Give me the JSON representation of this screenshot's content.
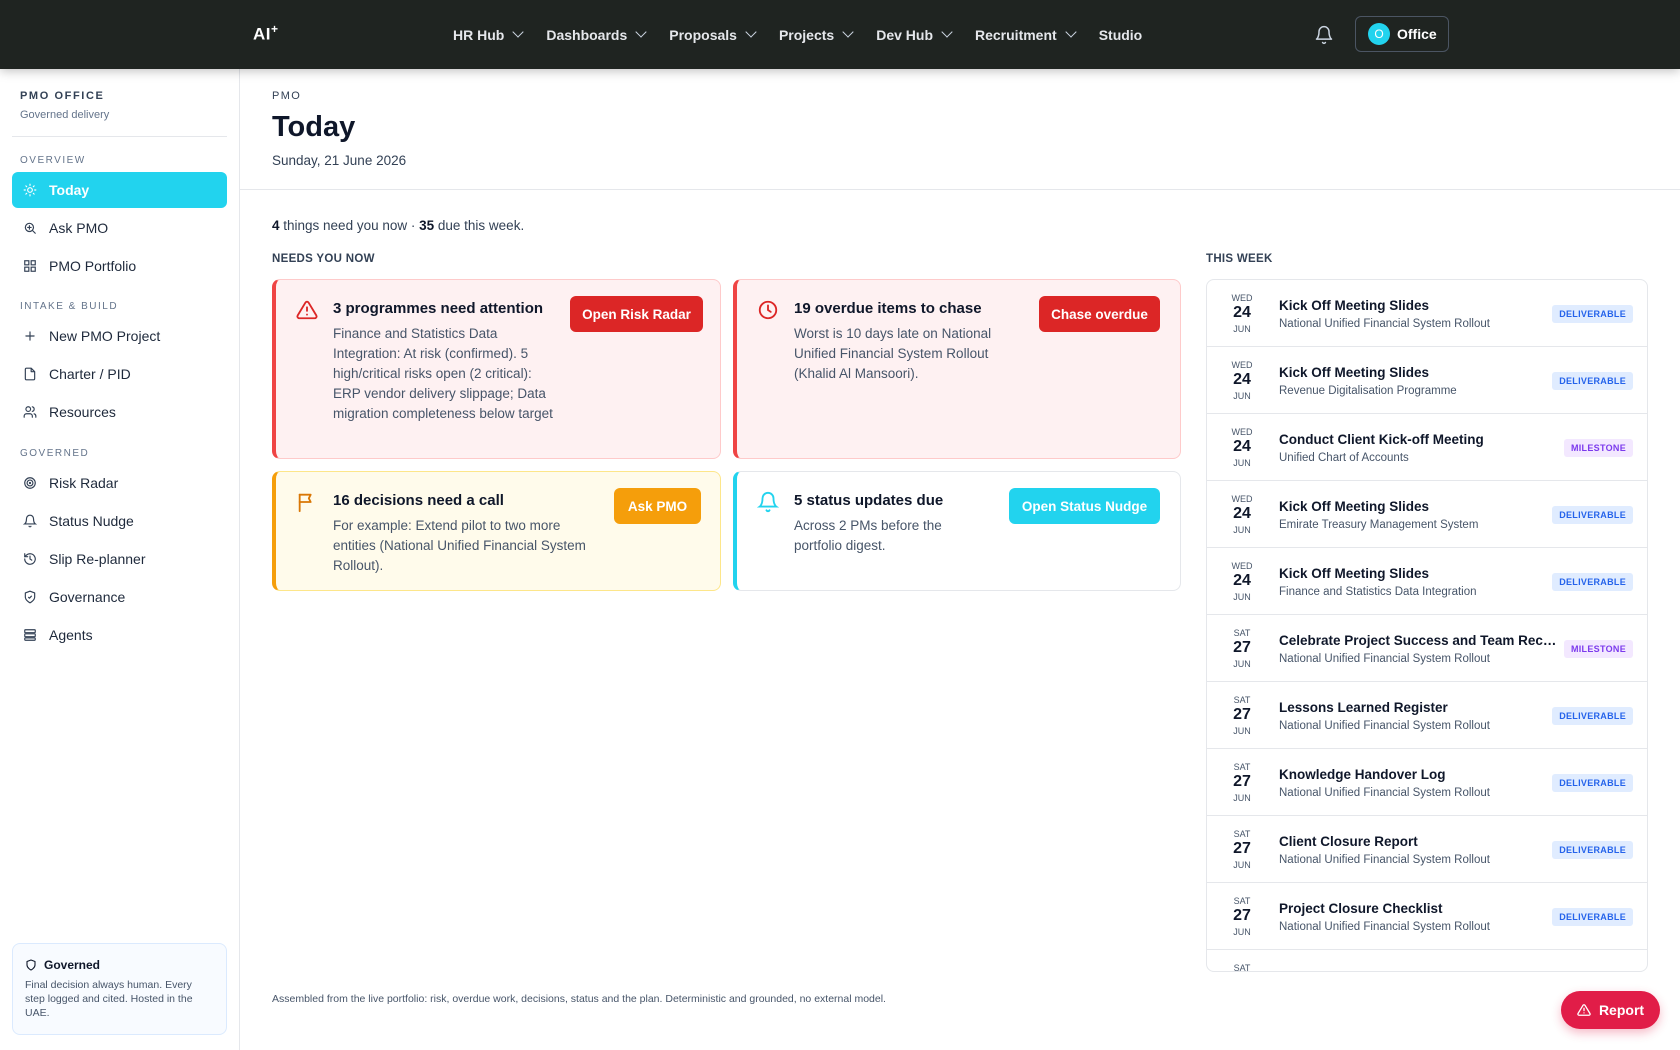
{
  "brand": {
    "logo": "AI",
    "logo_sup": "+"
  },
  "nav": {
    "items": [
      {
        "label": "HR Hub",
        "dropdown": true
      },
      {
        "label": "Dashboards",
        "dropdown": true
      },
      {
        "label": "Proposals",
        "dropdown": true
      },
      {
        "label": "Projects",
        "dropdown": true
      },
      {
        "label": "Dev Hub",
        "dropdown": true
      },
      {
        "label": "Recruitment",
        "dropdown": true
      },
      {
        "label": "Studio",
        "dropdown": false
      }
    ],
    "office_avatar": "O",
    "office_label": "Office"
  },
  "sidebar": {
    "title": "PMO OFFICE",
    "subtitle": "Governed delivery",
    "sections": {
      "overview": "OVERVIEW",
      "intake": "INTAKE & BUILD",
      "governed": "GOVERNED"
    },
    "items": [
      {
        "label": "Today",
        "icon": "sun-icon",
        "active": true
      },
      {
        "label": "Ask PMO",
        "icon": "search-icon"
      },
      {
        "label": "PMO Portfolio",
        "icon": "grid-icon"
      },
      {
        "label": "New PMO Project",
        "icon": "plus-icon"
      },
      {
        "label": "Charter / PID",
        "icon": "document-icon"
      },
      {
        "label": "Resources",
        "icon": "users-icon"
      },
      {
        "label": "Risk Radar",
        "icon": "radar-icon"
      },
      {
        "label": "Status Nudge",
        "icon": "bell-icon"
      },
      {
        "label": "Slip Re-planner",
        "icon": "history-icon"
      },
      {
        "label": "Governance",
        "icon": "shield-check-icon"
      },
      {
        "label": "Agents",
        "icon": "server-icon"
      }
    ],
    "governed_box": {
      "title": "Governed",
      "text": "Final decision always human. Every step logged and cited. Hosted in the UAE."
    }
  },
  "main": {
    "crumb": "PMO",
    "title": "Today",
    "date": "Sunday, 21 June 2026",
    "summary": {
      "now_count": "4",
      "now_text": " things need you now · ",
      "week_count": "35",
      "week_text": " due this week."
    },
    "needs_heading": "NEEDS YOU NOW",
    "week_heading": "THIS WEEK",
    "cards": [
      {
        "title": "3 programmes need attention",
        "body": "Finance and Statistics Data Integration: At risk (confirmed). 5 high/critical risks open (2 critical): ERP vendor delivery slippage; Data migration completeness below target",
        "button": "Open Risk Radar",
        "tone": "red",
        "icon": "warning-icon"
      },
      {
        "title": "19 overdue items to chase",
        "body": "Worst is 10 days late on National Unified Financial System Rollout (Khalid Al Mansoori).",
        "button": "Chase overdue",
        "tone": "red",
        "icon": "clock-icon"
      },
      {
        "title": "16 decisions need a call",
        "body": "For example: Extend pilot to two more entities (National Unified Financial System Rollout).",
        "button": "Ask PMO",
        "tone": "amber",
        "icon": "flag-icon"
      },
      {
        "title": "5 status updates due",
        "body": "Across 2 PMs before the portfolio digest.",
        "button": "Open Status Nudge",
        "tone": "cyan",
        "icon": "bell-icon"
      }
    ],
    "this_week": [
      {
        "dow": "WED",
        "day": "24",
        "mon": "JUN",
        "title": "Kick Off Meeting Slides",
        "project": "National Unified Financial System Rollout",
        "badge": "DELIVERABLE"
      },
      {
        "dow": "WED",
        "day": "24",
        "mon": "JUN",
        "title": "Kick Off Meeting Slides",
        "project": "Revenue Digitalisation Programme",
        "badge": "DELIVERABLE"
      },
      {
        "dow": "WED",
        "day": "24",
        "mon": "JUN",
        "title": "Conduct Client Kick-off Meeting",
        "project": "Unified Chart of Accounts",
        "badge": "MILESTONE"
      },
      {
        "dow": "WED",
        "day": "24",
        "mon": "JUN",
        "title": "Kick Off Meeting Slides",
        "project": "Emirate Treasury Management System",
        "badge": "DELIVERABLE"
      },
      {
        "dow": "WED",
        "day": "24",
        "mon": "JUN",
        "title": "Kick Off Meeting Slides",
        "project": "Finance and Statistics Data Integration",
        "badge": "DELIVERABLE"
      },
      {
        "dow": "SAT",
        "day": "27",
        "mon": "JUN",
        "title": "Celebrate Project Success and Team Reco...",
        "project": "National Unified Financial System Rollout",
        "badge": "MILESTONE"
      },
      {
        "dow": "SAT",
        "day": "27",
        "mon": "JUN",
        "title": "Lessons Learned Register",
        "project": "National Unified Financial System Rollout",
        "badge": "DELIVERABLE"
      },
      {
        "dow": "SAT",
        "day": "27",
        "mon": "JUN",
        "title": "Knowledge Handover Log",
        "project": "National Unified Financial System Rollout",
        "badge": "DELIVERABLE"
      },
      {
        "dow": "SAT",
        "day": "27",
        "mon": "JUN",
        "title": "Client Closure Report",
        "project": "National Unified Financial System Rollout",
        "badge": "DELIVERABLE"
      },
      {
        "dow": "SAT",
        "day": "27",
        "mon": "JUN",
        "title": "Project Closure Checklist",
        "project": "National Unified Financial System Rollout",
        "badge": "DELIVERABLE"
      },
      {
        "dow": "SAT",
        "day": "",
        "mon": "",
        "title": "",
        "project": "",
        "badge": ""
      }
    ],
    "footnote": "Assembled from the live portfolio: risk, overdue work, decisions, status and the plan. Deterministic and grounded, no external model.",
    "report_button": "Report"
  },
  "colors": {
    "accent": "#22d3ee",
    "danger": "#dc2626",
    "warning": "#f59e0b",
    "topbar": "#1f2421",
    "report": "#e11d48"
  }
}
